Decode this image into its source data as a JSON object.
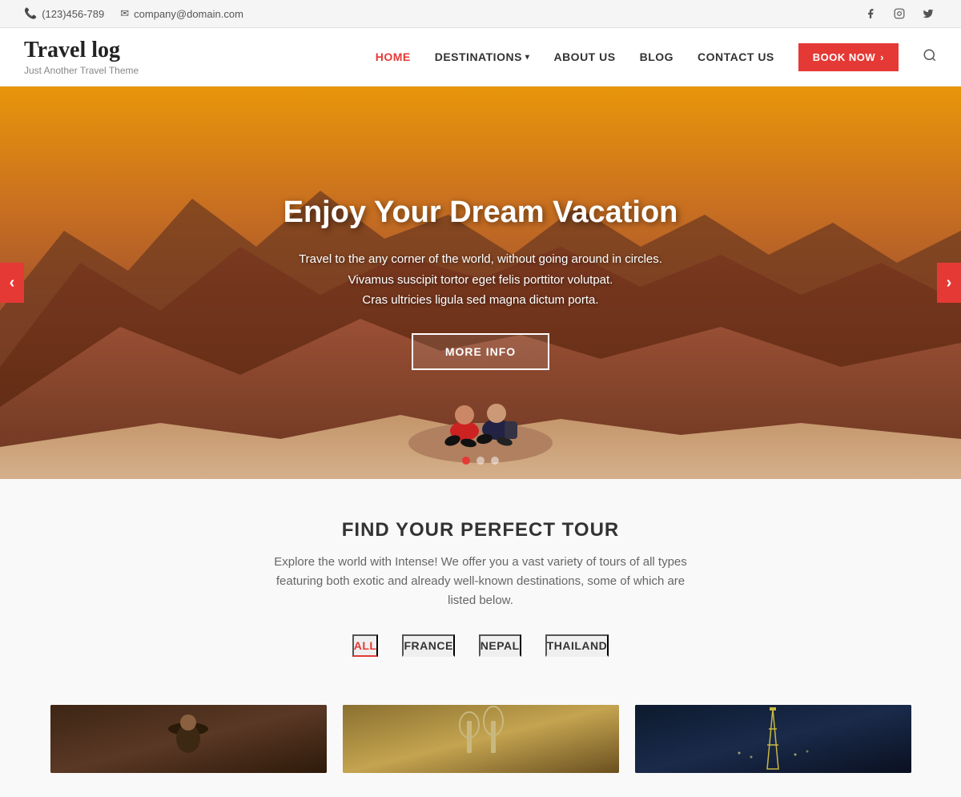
{
  "topbar": {
    "phone": "(123)456-789",
    "email": "company@domain.com",
    "phone_icon": "📞",
    "email_icon": "✉"
  },
  "header": {
    "logo_title": "Travel log",
    "logo_subtitle": "Just Another Travel Theme",
    "nav": [
      {
        "label": "HOME",
        "id": "home",
        "active": true
      },
      {
        "label": "DESTINATIONS",
        "id": "destinations",
        "has_dropdown": true
      },
      {
        "label": "ABOUT US",
        "id": "about"
      },
      {
        "label": "BLOG",
        "id": "blog"
      },
      {
        "label": "CONTACT US",
        "id": "contact"
      }
    ],
    "book_btn": "BOOK NOW",
    "book_btn_arrow": "›"
  },
  "hero": {
    "title": "Enjoy Your Dream Vacation",
    "description_line1": "Travel to the any corner of the world, without going around in circles.",
    "description_line2": "Vivamus suscipit tortor eget felis porttitor volutpat.",
    "description_line3": "Cras ultricies ligula sed magna dictum porta.",
    "cta_label": "MORE INFO",
    "arrow_left": "‹",
    "arrow_right": "›",
    "dots": [
      {
        "active": true
      },
      {
        "active": false
      },
      {
        "active": false
      }
    ]
  },
  "find_tour": {
    "title": "FIND YOUR PERFECT TOUR",
    "description": "Explore the world with Intense! We offer you a vast variety of tours of all types featuring both exotic and already well-known destinations, some of which are listed below.",
    "filters": [
      {
        "label": "ALL",
        "active": true
      },
      {
        "label": "FRANCE",
        "active": false
      },
      {
        "label": "NEPAL",
        "active": false
      },
      {
        "label": "THAILAND",
        "active": false
      }
    ]
  },
  "social": {
    "facebook": "f",
    "instagram": "◻",
    "twitter": "t"
  }
}
